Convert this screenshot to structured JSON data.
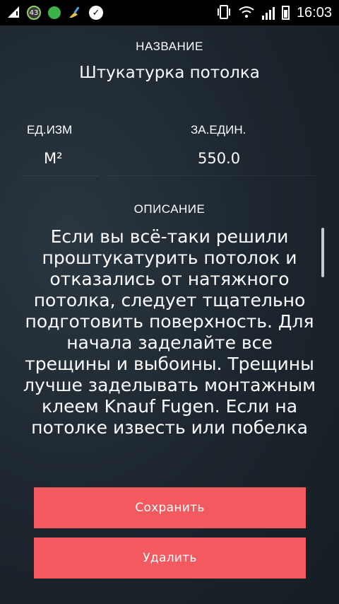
{
  "status_bar": {
    "badge": "43",
    "time": "16:03"
  },
  "form": {
    "name_label": "НАЗВАНИЕ",
    "name_value": "Штукатурка потолка",
    "unit_label": "ЕД.ИЗМ",
    "unit_value": "М²",
    "price_label": "ЗА.ЕДИН.",
    "price_value": "550.0",
    "description_label": "ОПИСАНИЕ",
    "description_value": "Если вы всё-таки решили проштукатурить потолок  и отказались от натяжного потолка, следует тщательно подготовить поверхность.  Для начала заделайте все трещины и выбоины. Трещины лучше заделывать монтажным клеем Knauf Fugen. Если на потолке известь или побелка"
  },
  "buttons": {
    "save": "Сохранить",
    "delete": "Удалить"
  },
  "colors": {
    "button": "#f25a5f",
    "background": "#202a33"
  }
}
